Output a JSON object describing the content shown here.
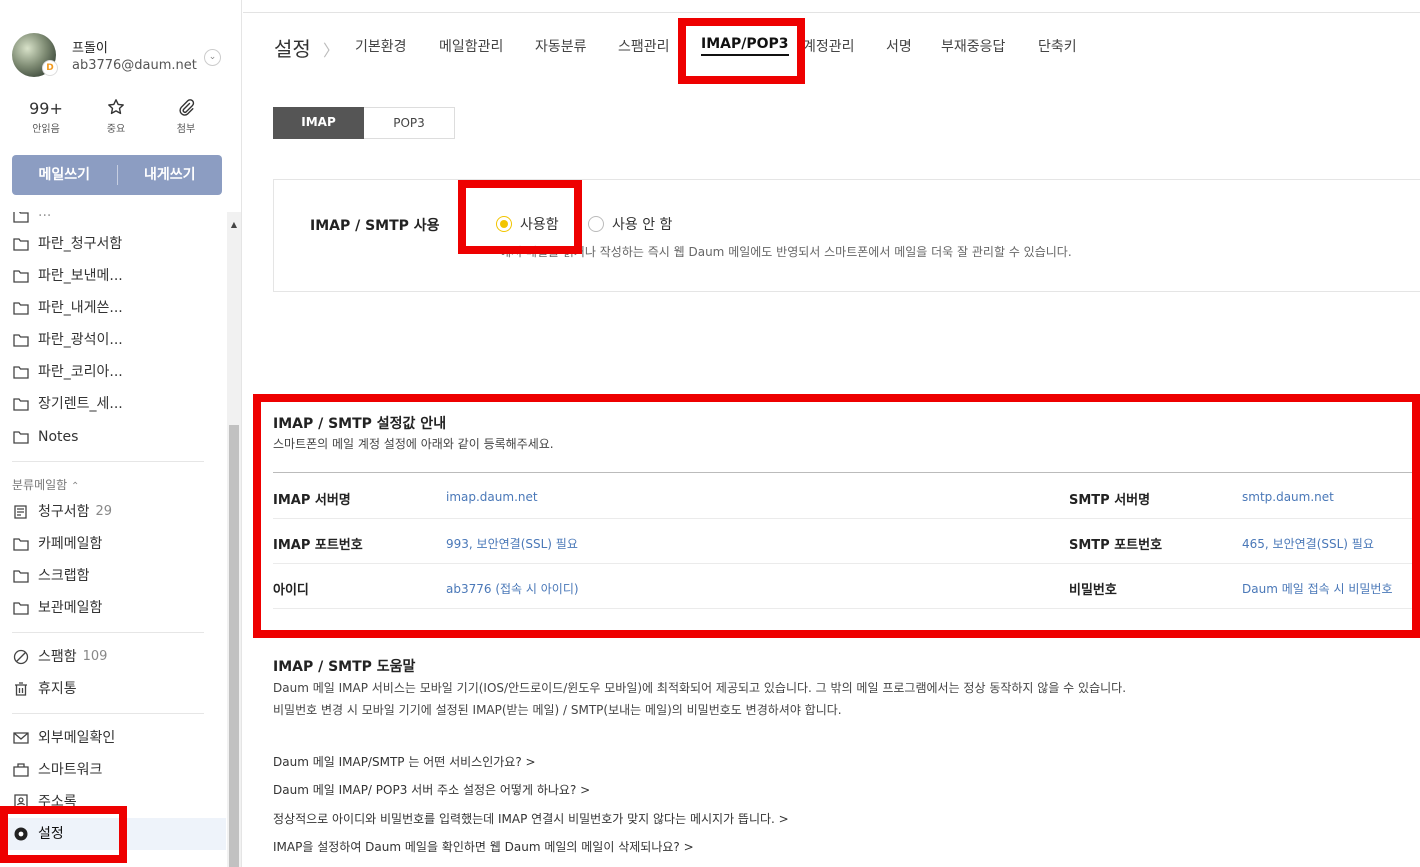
{
  "profile": {
    "name": "프돌이",
    "email": "ab3776@daum.net",
    "badge": "D"
  },
  "quick_stats": [
    {
      "value": "99+",
      "label": "안읽음"
    },
    {
      "icon": "star-icon",
      "label": "중요"
    },
    {
      "icon": "paperclip-icon",
      "label": "첨부"
    }
  ],
  "write_buttons": {
    "compose": "메일쓰기",
    "to_me": "내게쓰기"
  },
  "folders": [
    {
      "name": "파란_청구서함"
    },
    {
      "name": "파란_보낸메..."
    },
    {
      "name": "파란_내게쓴..."
    },
    {
      "name": "파란_광석이..."
    },
    {
      "name": "파란_코리아..."
    },
    {
      "name": "장기렌트_세..."
    },
    {
      "name": "Notes"
    }
  ],
  "category_section": {
    "label": "분류메일함",
    "items": [
      {
        "name": "청구서함",
        "count": "29"
      },
      {
        "name": "카페메일함"
      },
      {
        "name": "스크랩함"
      },
      {
        "name": "보관메일함"
      }
    ]
  },
  "system_folders": [
    {
      "name": "스팸함",
      "count": "109"
    },
    {
      "name": "휴지통"
    }
  ],
  "tools": [
    {
      "name": "외부메일확인"
    },
    {
      "name": "스마트워크"
    },
    {
      "name": "주소록"
    },
    {
      "name": "설정"
    }
  ],
  "settings_nav": {
    "title": "설정",
    "tabs": [
      "기본환경",
      "메일함관리",
      "자동분류",
      "스팸관리",
      "IMAP/POP3",
      "계정관리",
      "서명",
      "부재중응답",
      "단축키"
    ],
    "active_tab": "IMAP/POP3"
  },
  "protocol_tabs": {
    "imap": "IMAP",
    "pop3": "POP3"
  },
  "imap_use": {
    "label": "IMAP / SMTP 사용",
    "on_label": "사용함",
    "off_label": "사용 안 함",
    "selected": "on",
    "description": "에서 메일을 읽거나 작성하는 즉시 웹 Daum 메일에도 반영되서 스마트폰에서 메일을 더욱 잘 관리할 수 있습니다."
  },
  "info": {
    "title": "IMAP / SMTP 설정값 안내",
    "subtitle": "스마트폰의 메일 계정 설정에 아래와 같이 등록해주세요.",
    "rows": [
      {
        "l1": "IMAP 서버명",
        "v1": "imap.daum.net",
        "l2": "SMTP 서버명",
        "v2": "smtp.daum.net"
      },
      {
        "l1": "IMAP 포트번호",
        "v1": "993, 보안연결(SSL) 필요",
        "l2": "SMTP 포트번호",
        "v2": "465, 보안연결(SSL) 필요"
      },
      {
        "l1": "아이디",
        "v1": "ab3776 (접속 시 아이디)",
        "l2": "비밀번호",
        "v2": "Daum 메일 접속 시 비밀번호"
      }
    ]
  },
  "help": {
    "title": "IMAP / SMTP 도움말",
    "lines": [
      "Daum 메일 IMAP 서비스는 모바일 기기(IOS/안드로이드/윈도우 모바일)에 최적화되어 제공되고 있습니다. 그 밖의 메일 프로그램에서는 정상 동작하지 않을 수 있습니다.",
      "비밀번호 변경 시 모바일 기기에 설정된 IMAP(받는 메일) / SMTP(보내는 메일)의 비밀번호도 변경하셔야 합니다."
    ],
    "faqs": [
      "Daum 메일 IMAP/SMTP 는 어떤 서비스인가요? >",
      "Daum 메일 IMAP/ POP3 서버 주소 설정은 어떻게 하나요? >",
      "정상적으로 아이디와 비밀번호를 입력했는데 IMAP 연결시 비밀번호가 맞지 않다는 메시지가 뜹니다. >",
      "IMAP을 설정하여 Daum 메일을 확인하면 웹 Daum 메일의 메일이 삭제되나요? >"
    ]
  },
  "colors": {
    "highlight": "#ee0000",
    "accent_radio": "#f2c500",
    "link": "#4a78b8",
    "compose_bg": "#8c9dc2"
  }
}
